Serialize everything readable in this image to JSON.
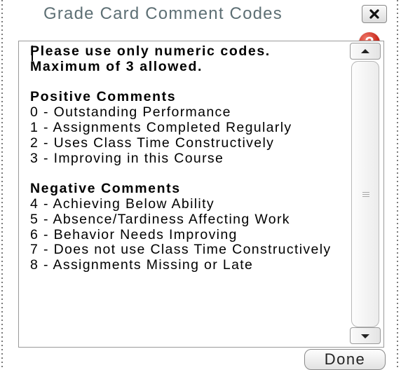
{
  "dialog": {
    "title": "Grade Card Comment Codes",
    "close_icon": "close-icon",
    "help_icon": "help-icon",
    "help_glyph": "?",
    "done_label": "Done",
    "accent_color": "#5d6f74",
    "help_color": "#c8261a"
  },
  "comments": {
    "intro": "Please use only numeric codes.  Maximum of 3 allowed.",
    "positive_heading": "Positive Comments",
    "positive": [
      "0 - Outstanding Performance",
      "1 - Assignments Completed Regularly",
      "2 - Uses Class Time Constructively",
      "3 - Improving in this Course"
    ],
    "negative_heading": "Negative Comments",
    "negative": [
      "4 - Achieving Below Ability",
      "5 - Absence/Tardiness Affecting Work",
      "6 - Behavior Needs Improving",
      "7 - Does not use Class Time Constructively",
      "8 - Assignments Missing or Late"
    ]
  },
  "scrollbar": {
    "up_icon": "scroll-up-arrow-icon",
    "down_icon": "scroll-down-arrow-icon"
  }
}
